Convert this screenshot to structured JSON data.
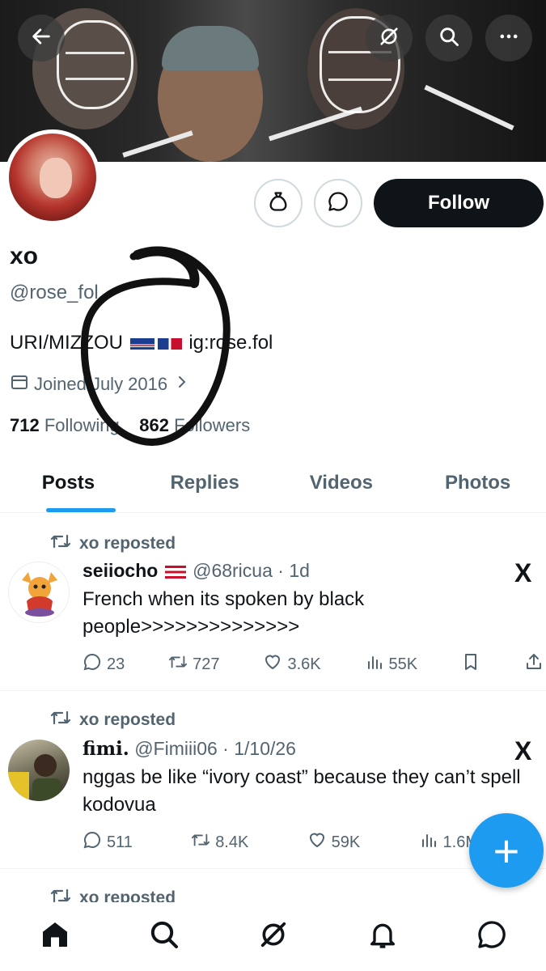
{
  "profile": {
    "name": "xo",
    "handle": "@rose_fol",
    "bio_prefix": "URI/MIZZOU",
    "bio_suffix": "ig:rose.fol",
    "joined": "Joined July 2016",
    "following_count": "712",
    "following_label": "Following",
    "followers_count": "862",
    "followers_label": "Followers"
  },
  "actions": {
    "follow_label": "Follow"
  },
  "tabs": [
    {
      "label": "Posts",
      "active": true
    },
    {
      "label": "Replies",
      "active": false
    },
    {
      "label": "Videos",
      "active": false
    },
    {
      "label": "Photos",
      "active": false
    }
  ],
  "posts": [
    {
      "repost_label": "xo reposted",
      "author": "seiiocho",
      "flag": "puerto-rico-flag",
      "handle_time": "@68ricua · 1d",
      "text": "French when its spoken by black people>>>>>>>>>>>>>>",
      "replies": "23",
      "reposts": "727",
      "likes": "3.6K",
      "views": "55K"
    },
    {
      "repost_label": "xo reposted",
      "author": "fimi.",
      "handle_time": "@Fimiii06 · 1/10/26",
      "text": "nggas be like “ivory coast” because they can’t spell kodovua",
      "replies": "511",
      "reposts": "8.4K",
      "likes": "59K",
      "views": "1.6M"
    },
    {
      "repost_label": "xo reposted"
    }
  ],
  "icons": {
    "back": "back-arrow-icon",
    "grok": "grok-icon",
    "search": "search-icon",
    "more": "more-icon",
    "tip": "money-bag-icon",
    "message": "message-icon",
    "calendar": "calendar-icon",
    "x_logo": "X",
    "fab": "+"
  },
  "colors": {
    "accent": "#1d9bf0",
    "follow_bg": "#0f1419",
    "muted": "#536471"
  }
}
